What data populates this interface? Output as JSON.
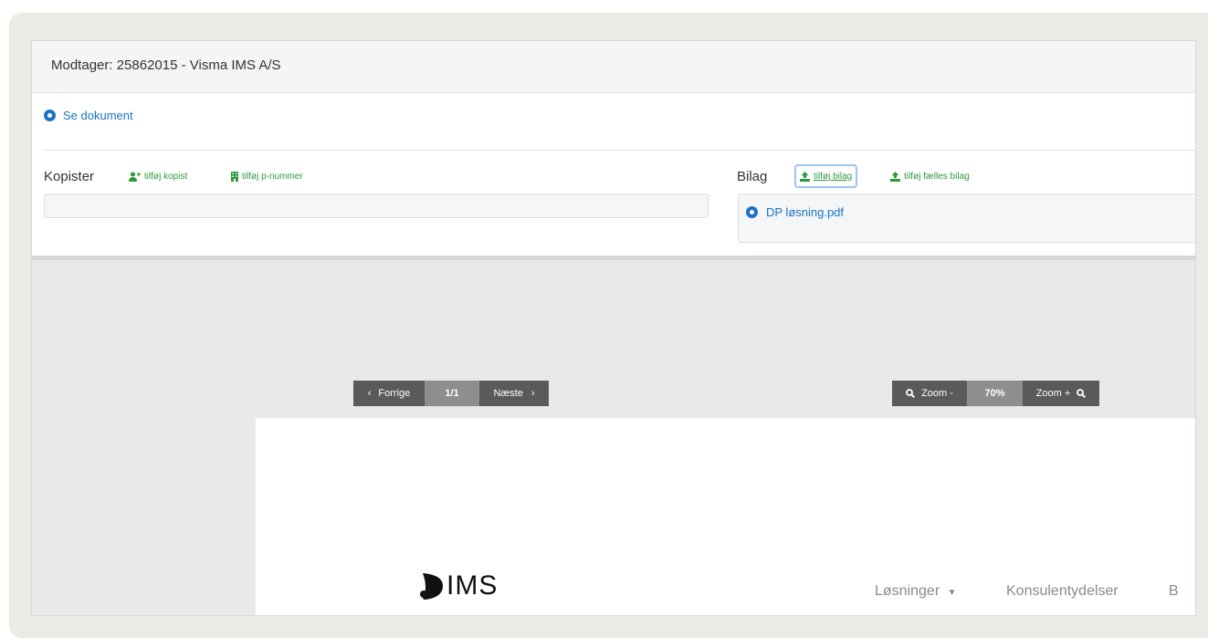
{
  "header": {
    "title": "Modtager: 25862015 - Visma IMS A/S"
  },
  "document_link": {
    "label": "Se dokument"
  },
  "kopister": {
    "label": "Kopister",
    "add_copy_label": "tilføj kopist",
    "add_pnumber_label": "tilføj p-nummer"
  },
  "bilag": {
    "label": "Bilag",
    "add_attachment_label": "tilføj bilag",
    "add_shared_attachment_label": "tilføj fælles bilag",
    "files": [
      {
        "name": "DP løsning.pdf"
      }
    ]
  },
  "viewer": {
    "prev_label": "Forrige",
    "page_indicator": "1/1",
    "next_label": "Næste",
    "zoom_out_label": "Zoom -",
    "zoom_level": "70%",
    "zoom_in_label": "Zoom +"
  },
  "preview": {
    "logo_text": "IMS",
    "nav_items": [
      "Løsninger",
      "Konsulentydelser",
      "B"
    ]
  },
  "colors": {
    "link": "#1a73c7",
    "action_green": "#2c9a3c",
    "toolbar_dark": "#5a5a5a",
    "toolbar_mid": "#8e8e8e"
  }
}
